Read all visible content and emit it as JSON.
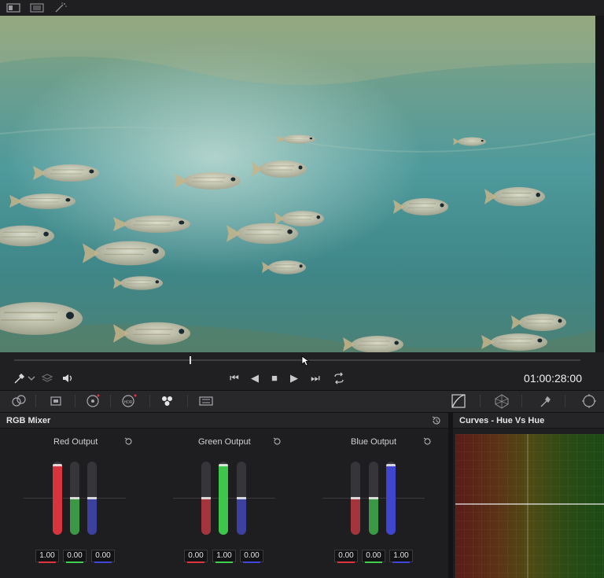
{
  "transport": {
    "timecode": "01:00:28:00"
  },
  "mixer": {
    "title": "RGB Mixer",
    "outputs": [
      {
        "label": "Red Output",
        "values": [
          "1.00",
          "0.00",
          "0.00"
        ],
        "levels": [
          1.0,
          0.0,
          0.0
        ]
      },
      {
        "label": "Green Output",
        "values": [
          "0.00",
          "1.00",
          "0.00"
        ],
        "levels": [
          0.0,
          1.0,
          0.0
        ]
      },
      {
        "label": "Blue Output",
        "values": [
          "0.00",
          "0.00",
          "1.00"
        ],
        "levels": [
          0.0,
          0.0,
          1.0
        ]
      }
    ],
    "channel_colors": [
      "#e0353d",
      "#3fcf4d",
      "#4147d6"
    ]
  },
  "curves": {
    "title": "Curves - Hue Vs Hue"
  },
  "icons": {
    "top": [
      "viewer-layout-icon",
      "split-view-icon",
      "magic-wand-icon"
    ],
    "transport": [
      "eyedropper-icon",
      "chevron-down-icon",
      "layers-icon",
      "speaker-icon",
      "skip-start-icon",
      "play-reverse-icon",
      "stop-icon",
      "play-icon",
      "skip-end-icon",
      "loop-icon"
    ],
    "palette": [
      "camera-raw-icon",
      "color-match-icon",
      "color-wheels-icon",
      "hdr-icon",
      "rgb-mixer-icon",
      "motion-effects-icon",
      "curves-icon",
      "color-warper-icon",
      "qualifier-icon",
      "window-icon"
    ]
  }
}
